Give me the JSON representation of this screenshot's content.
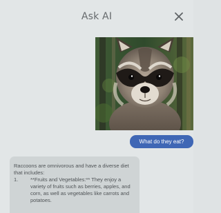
{
  "header": {
    "title": "Ask AI",
    "close_icon": "close-icon"
  },
  "chat": {
    "image_subject": "raccoon",
    "user_message": "What do they eat?",
    "ai_response": {
      "intro": "Raccoons are omnivorous and have a diverse diet that includes:",
      "items": [
        {
          "number": "1.",
          "text": "**Fruits and Vegetables:** They enjoy a variety of fruits such as berries, apples, and corn, as well as vegetables like carrots and potatoes."
        }
      ]
    }
  },
  "colors": {
    "background": "#e2e6e7",
    "user_bubble": "#3f67b5",
    "ai_bubble": "#cfd4d5",
    "title_text": "#666a6d"
  }
}
